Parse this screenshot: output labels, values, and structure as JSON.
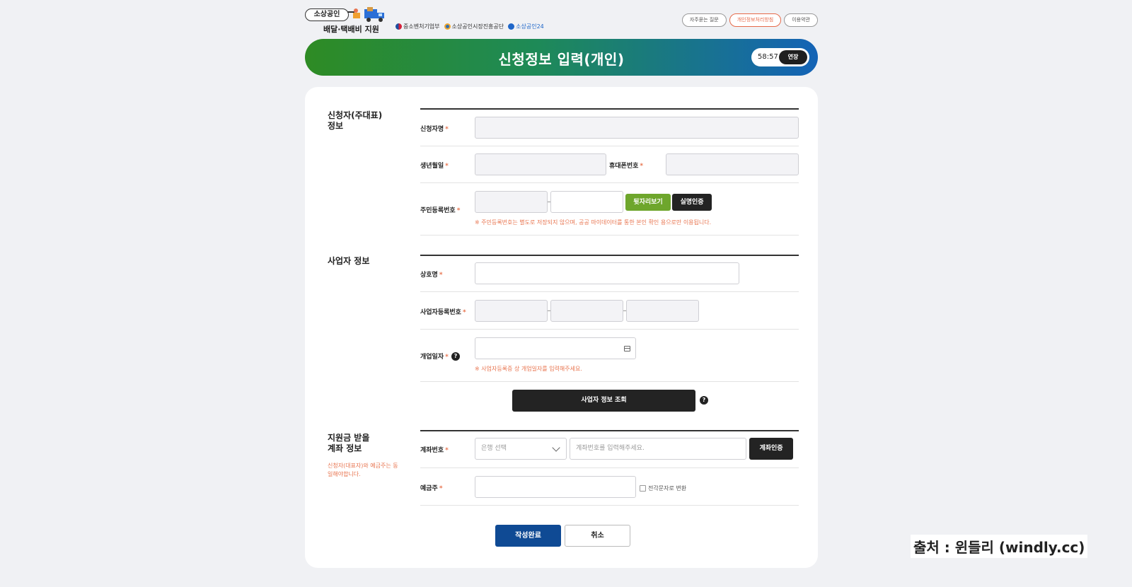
{
  "header": {
    "logo_pill": "소상공인",
    "logo_title": "배달·택배비 지원",
    "orgs": [
      "중소벤처기업부",
      "소상공인시장진흥공단",
      "소상공인24"
    ],
    "links": [
      {
        "label": "자주묻는 질문",
        "active": false
      },
      {
        "label": "개인정보처리방침",
        "active": true
      },
      {
        "label": "이용약관",
        "active": false
      }
    ]
  },
  "banner": {
    "title": "신청정보 입력(개인)",
    "timer": "58:57",
    "extend_label": "연장"
  },
  "applicant": {
    "section_title_line1": "신청자(주대표)",
    "section_title_line2": "정보",
    "name_label": "신청자명",
    "birth_label": "생년월일",
    "phone_label": "휴대폰번호",
    "rrn_label": "주민등록번호",
    "rrn_view_btn": "뒷자리보기",
    "rrn_verify_btn": "실명인증",
    "rrn_hint": "※ 주민등록번호는 별도로 저장되지 않으며, 공공 마이데이터를 통한 본인 확인 용으로만 이용됩니다."
  },
  "business": {
    "section_title": "사업자 정보",
    "trade_name_label": "상호명",
    "reg_no_label": "사업자등록번호",
    "open_date_label": "개업일자",
    "open_date_hint": "※ 사업자등록증 상 개업일자를 입력해주세요.",
    "lookup_btn": "사업자 정보 조회"
  },
  "account": {
    "section_title_line1": "지원금 받을",
    "section_title_line2": "계좌 정보",
    "section_note": "신청자(대표자)와 예금주는 동일해야합니다.",
    "account_no_label": "계좌번호",
    "bank_select_placeholder": "은행 선택",
    "account_input_placeholder": "계좌번호를 입력해주세요.",
    "account_verify_btn": "계좌인증",
    "holder_label": "예금주",
    "convert_label": "전각문자로 변환"
  },
  "actions": {
    "submit": "작성완료",
    "cancel": "취소"
  },
  "credit": "출처 : 윈들리 (windly.cc)",
  "required_mark": "*",
  "help_mark": "?",
  "colors": {
    "accent_orange": "#e8744f",
    "navy": "#0f4a94",
    "green": "#6ea62c",
    "banner_start": "#2e8b24",
    "banner_end": "#1463b6"
  }
}
